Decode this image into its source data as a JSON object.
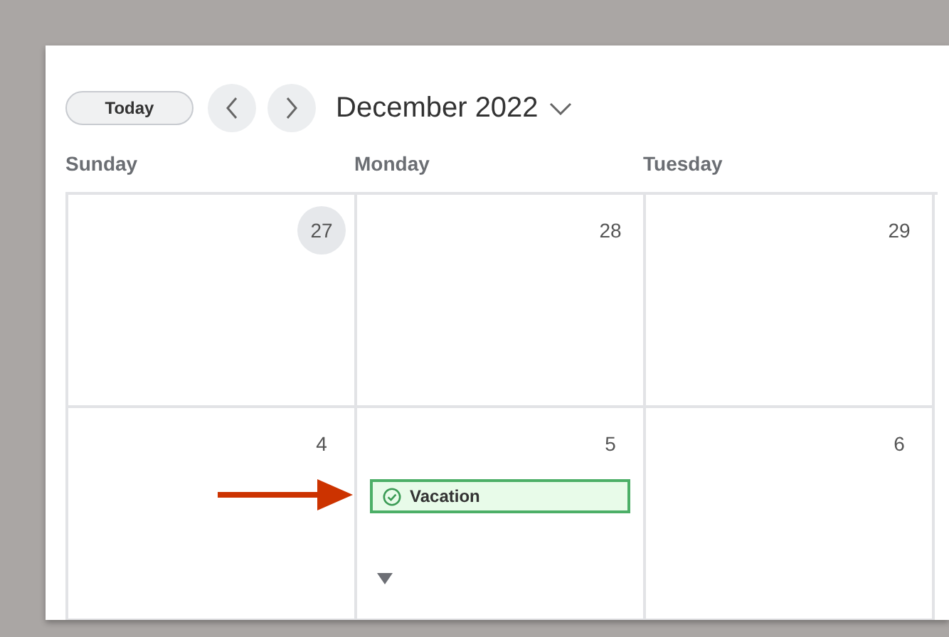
{
  "toolbar": {
    "today_button": "Today",
    "month": "December 2022"
  },
  "weekdays": [
    "Sunday",
    "Monday",
    "Tuesday"
  ],
  "weeks": [
    {
      "days": [
        {
          "number": "27",
          "today": true
        },
        {
          "number": "28",
          "today": false
        },
        {
          "number": "29",
          "today": false
        }
      ]
    },
    {
      "days": [
        {
          "number": "4",
          "today": false
        },
        {
          "number": "5",
          "today": false,
          "events": [
            {
              "title": "Vacation",
              "kind": "approved"
            }
          ],
          "more": true
        },
        {
          "number": "6",
          "today": false
        }
      ]
    }
  ],
  "annotation": {
    "kind": "arrow"
  }
}
